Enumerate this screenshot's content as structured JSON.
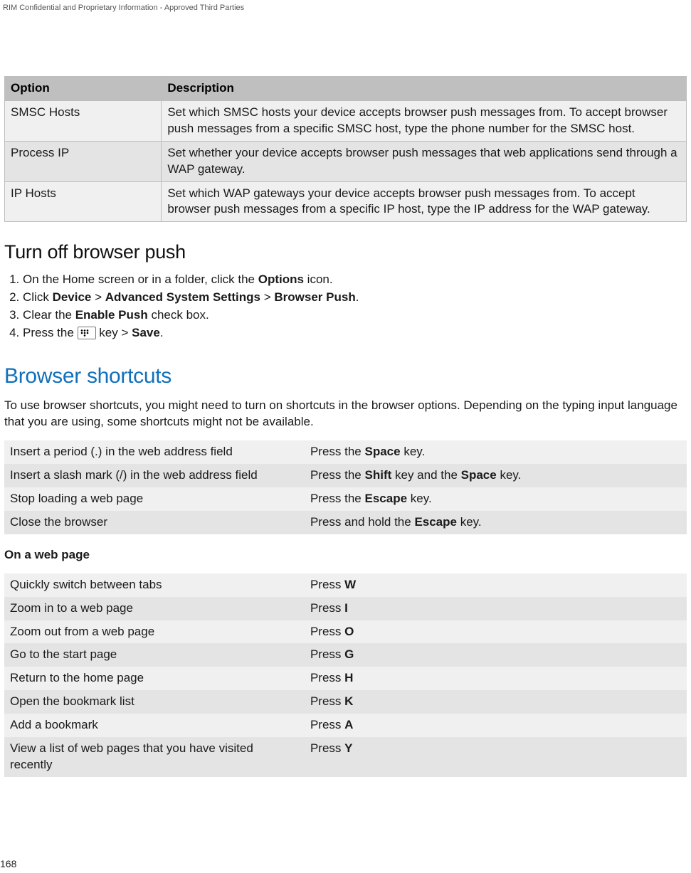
{
  "header": {
    "confidential": "RIM Confidential and Proprietary Information - Approved Third Parties"
  },
  "options_table": {
    "columns": {
      "c1": "Option",
      "c2": "Description"
    },
    "rows": [
      {
        "c1": "SMSC Hosts",
        "c2": "Set which SMSC hosts your device accepts browser push messages from. To accept browser push messages from a specific SMSC host, type the phone number for the SMSC host."
      },
      {
        "c1": "Process IP",
        "c2": "Set whether your device accepts browser push messages that web applications send through a WAP gateway."
      },
      {
        "c1": "IP Hosts",
        "c2": "Set which WAP gateways your device accepts browser push messages from. To accept browser push messages from a specific IP host, type the IP address for the WAP gateway."
      }
    ]
  },
  "turn_off": {
    "heading": "Turn off browser push",
    "steps": {
      "s1_a": "On the Home screen or in a folder, click the ",
      "s1_b": "Options",
      "s1_c": " icon.",
      "s2_a": "Click ",
      "s2_b": "Device",
      "s2_c": " > ",
      "s2_d": "Advanced System Settings",
      "s2_e": " > ",
      "s2_f": "Browser Push",
      "s2_g": ".",
      "s3_a": "Clear the ",
      "s3_b": "Enable Push",
      "s3_c": " check box.",
      "s4_a": "Press the ",
      "s4_b": " key > ",
      "s4_c": "Save",
      "s4_d": "."
    }
  },
  "shortcuts": {
    "heading": "Browser shortcuts",
    "intro": "To use browser shortcuts, you might need to turn on shortcuts in the browser options. Depending on the typing input language that you are using, some shortcuts might not be available.",
    "table1": [
      {
        "action": "Insert a period (.) in the web address field",
        "key_a": "Press the ",
        "key_b": "Space",
        "key_c": " key."
      },
      {
        "action": "Insert a slash mark (/) in the web address field",
        "key_a": "Press the ",
        "key_b": "Shift",
        "key_c": " key and the ",
        "key_d": "Space",
        "key_e": " key."
      },
      {
        "action": "Stop loading a web page",
        "key_a": "Press the ",
        "key_b": "Escape",
        "key_c": " key."
      },
      {
        "action": "Close the browser",
        "key_a": "Press and hold the ",
        "key_b": "Escape",
        "key_c": " key."
      }
    ],
    "subhead": "On a web page",
    "table2": [
      {
        "action": "Quickly switch between tabs",
        "key_a": "Press ",
        "key_b": "W"
      },
      {
        "action": "Zoom in to a web page",
        "key_a": "Press ",
        "key_b": "I"
      },
      {
        "action": "Zoom out from a web page",
        "key_a": "Press ",
        "key_b": "O"
      },
      {
        "action": "Go to the start page",
        "key_a": "Press ",
        "key_b": "G"
      },
      {
        "action": "Return to the home page",
        "key_a": "Press ",
        "key_b": "H"
      },
      {
        "action": "Open the bookmark list",
        "key_a": "Press ",
        "key_b": "K"
      },
      {
        "action": "Add a bookmark",
        "key_a": "Press ",
        "key_b": "A"
      },
      {
        "action": "View a list of web pages that you have visited recently",
        "key_a": "Press ",
        "key_b": "Y"
      }
    ]
  },
  "page_number": "168"
}
